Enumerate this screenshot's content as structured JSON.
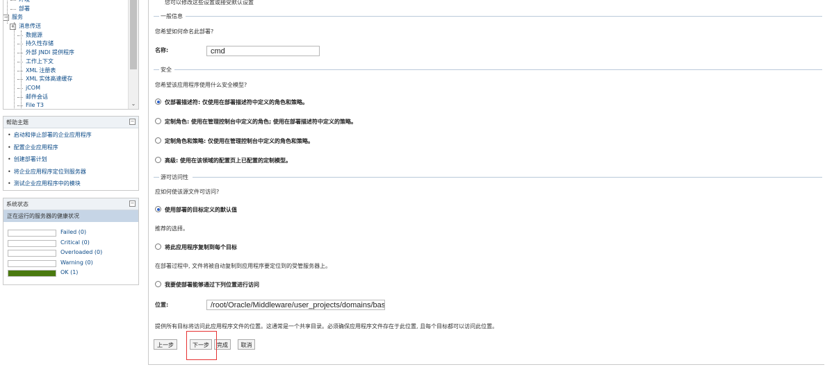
{
  "tree": {
    "items": [
      {
        "label": "环境",
        "level": 1,
        "expander": ""
      },
      {
        "label": "部署",
        "level": 1,
        "expander": ""
      },
      {
        "label": "服务",
        "level": 0,
        "expander": "⊟"
      },
      {
        "label": "消息传送",
        "level": 1,
        "expander": "⊞"
      },
      {
        "label": "数据源",
        "level": 2,
        "expander": ""
      },
      {
        "label": "持久性存储",
        "level": 2,
        "expander": ""
      },
      {
        "label": "外部 JNDI 提供程序",
        "level": 2,
        "expander": ""
      },
      {
        "label": "工作上下文",
        "level": 2,
        "expander": ""
      },
      {
        "label": "XML 注册表",
        "level": 2,
        "expander": ""
      },
      {
        "label": "XML 实体高速缓存",
        "level": 2,
        "expander": ""
      },
      {
        "label": "jCOM",
        "level": 2,
        "expander": ""
      },
      {
        "label": "邮件会话",
        "level": 2,
        "expander": ""
      },
      {
        "label": "File T3",
        "level": 2,
        "expander": ""
      }
    ]
  },
  "help": {
    "title": "帮助主题",
    "items": [
      "启动和停止部署的企业应用程序",
      "配置企业应用程序",
      "创建部署计划",
      "将企业应用程序定位到服务器",
      "测试企业应用程序中的模块"
    ]
  },
  "system_status": {
    "title": "系统状态",
    "subtitle": "正在运行的服务器的健康状况",
    "rows": [
      {
        "label": "Failed (0)",
        "fraction": 0
      },
      {
        "label": "Critical (0)",
        "fraction": 0
      },
      {
        "label": "Overloaded (0)",
        "fraction": 0
      },
      {
        "label": "Warning (0)",
        "fraction": 0
      },
      {
        "label": "OK (1)",
        "fraction": 1
      }
    ],
    "ok_color": "#4a7a0f"
  },
  "main": {
    "top_message": "您可以修改这些设置或接受默认设置",
    "general": {
      "legend": "一般信息",
      "question": "您希望如何命名此部署?",
      "name_label": "名称:",
      "name_value": "cmd"
    },
    "security": {
      "legend": "安全",
      "question": "您希望该应用程序使用什么安全模型?",
      "options": [
        {
          "label": "仅部署描述符: 仅使用在部署描述符中定义的角色和策略。",
          "selected": true
        },
        {
          "label": "定制角色: 使用在管理控制台中定义的角色; 使用在部署描述符中定义的策略。",
          "selected": false
        },
        {
          "label": "定制角色和策略: 仅使用在管理控制台中定义的角色和策略。",
          "selected": false
        },
        {
          "label": "高级: 使用在该领域的配置页上已配置的定制模型。",
          "selected": false
        }
      ]
    },
    "source": {
      "legend": "源可访问性",
      "question": "应如何使该源文件可访问?",
      "option1": "使用部署的目标定义的默认值",
      "option1_hint": "推荐的选择。",
      "option2": "将此应用程序复制到每个目标",
      "option2_hint": "在部署过程中, 文件将被自动复制到应用程序要定位到的受管服务器上。",
      "option3": "我要使部署能够通过下列位置进行访问",
      "location_label": "位置:",
      "location_value": "/root/Oracle/Middleware/user_projects/domains/base_",
      "footer_note": "提供所有目标将访问此应用程序文件的位置。这通常是一个共享目录。必须确保应用程序文件存在于此位置, 且每个目标都可以访问此位置。"
    },
    "buttons": {
      "back": "上一步",
      "next": "下一步",
      "finish": "完成",
      "cancel": "取消"
    }
  },
  "colors": {
    "link": "#0b4a87",
    "highlight": "#e53030",
    "status_header": "#c6d5e6"
  }
}
